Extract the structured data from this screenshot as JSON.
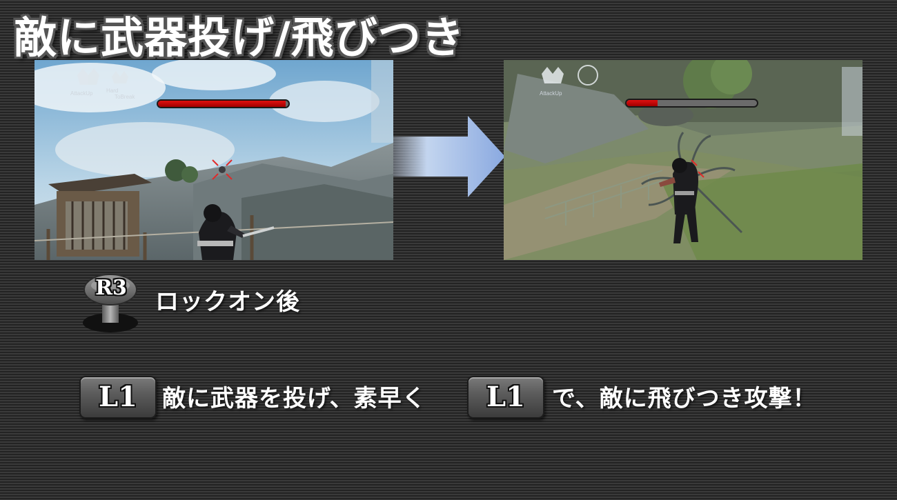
{
  "title": "敵に武器投げ/飛びつき",
  "screens": {
    "before": {
      "buffs": [
        "AttackUp",
        "Hard",
        "ToBreak"
      ],
      "enemy_hp_fraction": 0.98
    },
    "after": {
      "buffs": [
        "AttackUp"
      ],
      "enemy_hp_fraction": 0.24
    }
  },
  "controls": {
    "lockon": {
      "button": "R3",
      "text": "ロックオン後"
    },
    "attack": {
      "button_first": "L1",
      "text_first": "敵に武器を投げ、素早く",
      "button_second": "L1",
      "text_second": "で、敵に飛びつき攻撃！"
    }
  },
  "colors": {
    "hp_fill": "#d01010",
    "arrow": "#8fb0e8"
  }
}
